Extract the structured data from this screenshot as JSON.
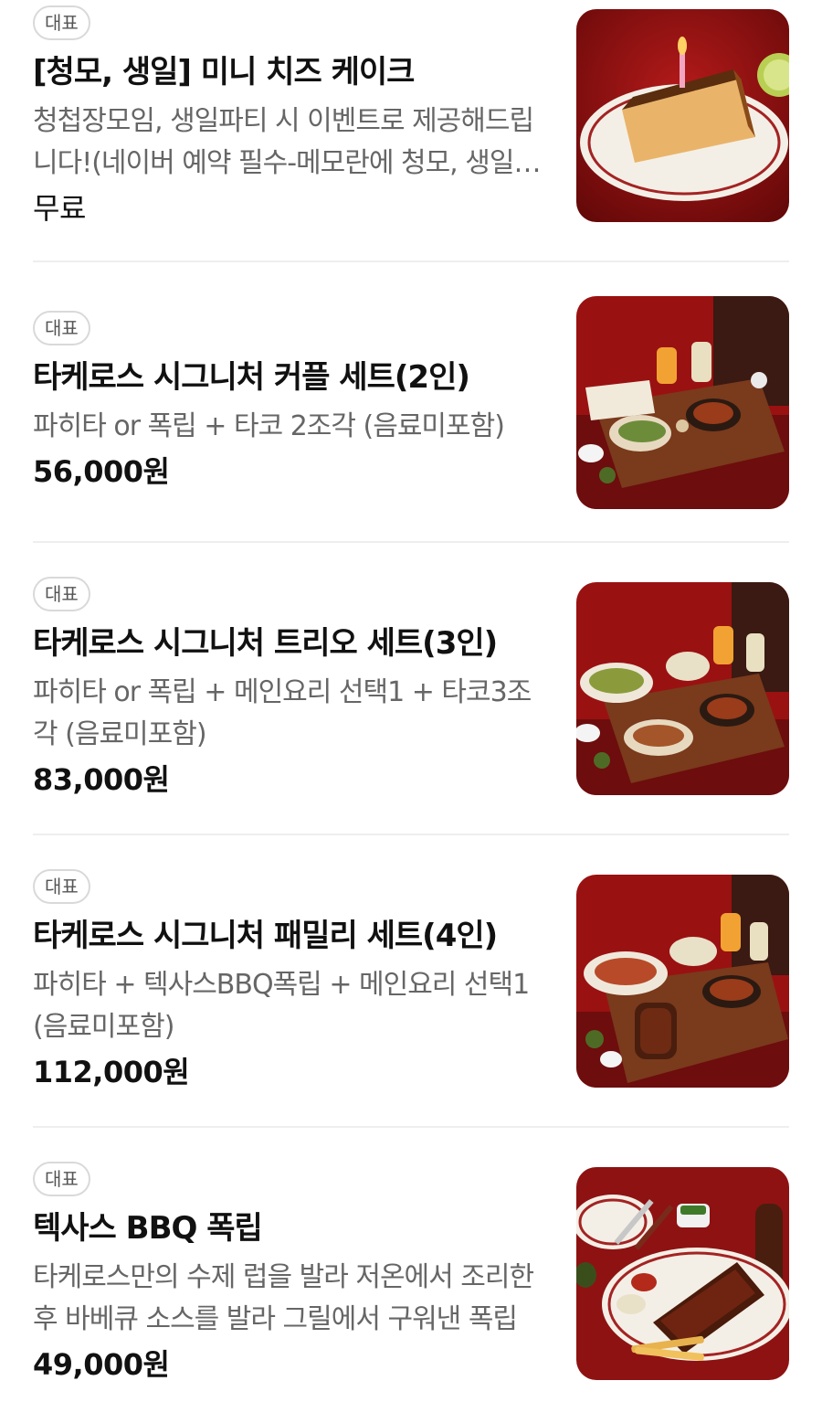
{
  "menu": {
    "items": [
      {
        "badge": "대표",
        "title": "[청모, 생일] 미니 치즈 케이크",
        "description": "청첩장모임, 생일파티 시 이벤트로 제공해드립니다!(네이버 예약 필수-메모란에 청모, 생일 기재)",
        "price": "무료"
      },
      {
        "badge": "대표",
        "title": "타케로스 시그니처 커플 세트(2인)",
        "description": "파히타 or 폭립 + 타코 2조각 (음료미포함)",
        "price": "56,000원"
      },
      {
        "badge": "대표",
        "title": "타케로스 시그니처 트리오 세트(3인)",
        "description": "파히타 or 폭립 + 메인요리 선택1 + 타코3조각 (음료미포함)",
        "price": "83,000원"
      },
      {
        "badge": "대표",
        "title": "타케로스 시그니처 패밀리 세트(4인)",
        "description": "파히타 + 텍사스BBQ폭립 + 메인요리 선택1 (음료미포함)",
        "price": "112,000원"
      },
      {
        "badge": "대표",
        "title": "텍사스 BBQ 폭립",
        "description": "타케로스만의 수제 럽을 발라 저온에서 조리한 후 바베큐 소스를 발라 그릴에서 구워낸 폭립",
        "price": "49,000원"
      }
    ]
  },
  "colors": {
    "badge_border": "#d9d9d9",
    "desc_text": "#666666",
    "divider": "#eeeeee",
    "food_background_red": "#8e1212"
  }
}
